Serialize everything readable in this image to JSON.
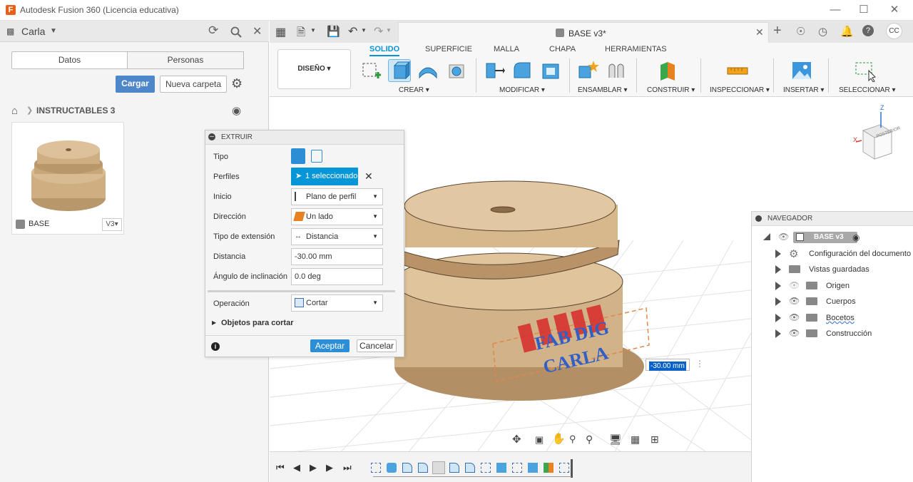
{
  "window": {
    "title": "Autodesk Fusion 360 (Licencia educativa)",
    "logo": "F"
  },
  "left": {
    "user": "Carla",
    "tabs": [
      "Datos",
      "Personas"
    ],
    "upload": "Cargar",
    "new_folder": "Nueva carpeta",
    "breadcrumb": "INSTRUCTABLES 3",
    "item_name": "BASE",
    "item_version": "V3"
  },
  "doc": {
    "tab_title": "BASE v3*",
    "user_initials": "CC"
  },
  "ribbon": {
    "workspace": "DISEÑO",
    "tabs": [
      "SOLIDO",
      "SUPERFICIE",
      "MALLA",
      "CHAPA",
      "HERRAMIENTAS"
    ],
    "groups": [
      "CREAR",
      "MODIFICAR",
      "ENSAMBLAR",
      "CONSTRUIR",
      "INSPECCIONAR",
      "INSERTAR",
      "SELECCIONAR"
    ]
  },
  "dialog": {
    "title": "EXTRUIR",
    "tipo": "Tipo",
    "perfiles": "Perfiles",
    "perfiles_value": "1 seleccionado",
    "inicio": "Inicio",
    "inicio_value": "Plano de perfil",
    "direccion": "Dirección",
    "direccion_value": "Un lado",
    "tipo_ext": "Tipo de extensión",
    "tipo_ext_value": "Distancia",
    "distancia": "Distancia",
    "distancia_value": "-30.00 mm",
    "angulo": "Ángulo de inclinación",
    "angulo_value": "0.0 deg",
    "operacion": "Operación",
    "operacion_value": "Cortar",
    "objetos": "Objetos para cortar",
    "ok": "Aceptar",
    "cancel": "Cancelar"
  },
  "viewport": {
    "text_line1": "FAB DIG",
    "text_line2": "CARLA",
    "dim_value": "-30.00 mm",
    "viewcube": {
      "z": "Z",
      "x": "X",
      "face": "POSTERIOR"
    }
  },
  "navigator": {
    "title": "NAVEGADOR",
    "root": "BASE v3",
    "items": [
      "Configuración del documento",
      "Vistas guardadas",
      "Origen",
      "Cuerpos",
      "Bocetos",
      "Construcción"
    ]
  },
  "colors": {
    "accent": "#0696d7",
    "model": "#d6b78e",
    "cut": "#d62b2b"
  }
}
